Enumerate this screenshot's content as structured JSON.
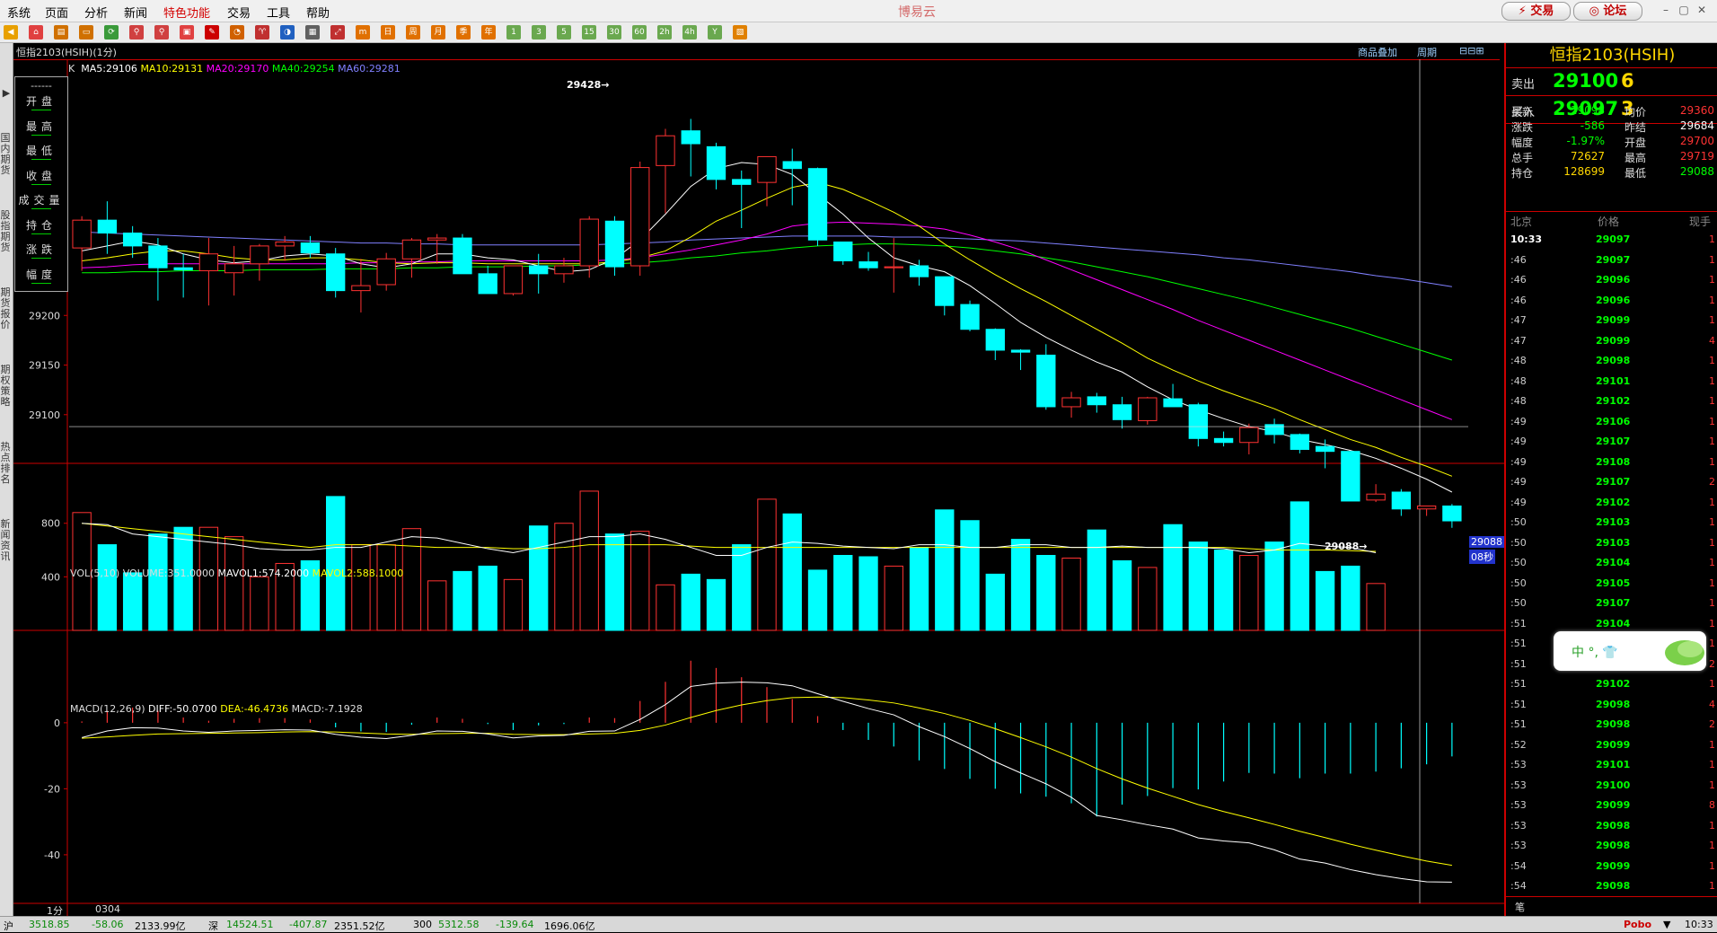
{
  "app_title": "博易云",
  "menu": [
    "系统",
    "页面",
    "分析",
    "新闻",
    "特色功能",
    "交易",
    "工具",
    "帮助"
  ],
  "menu_active_index": 4,
  "buttons": {
    "trade": "⚡ 交易",
    "forum": "◎ 论坛"
  },
  "toolbar": {
    "buttons": [
      "◀",
      "⌂",
      "▤",
      "▭",
      "⟳",
      "⚲",
      "⚲",
      "▣",
      "✎",
      "◔",
      "♈",
      "◑",
      "▦",
      "⤢",
      "m",
      "日",
      "周",
      "月",
      "季",
      "年",
      "1",
      "3",
      "5",
      "15",
      "30",
      "60",
      "2h",
      "4h",
      "Y",
      "▧"
    ],
    "colors": [
      "#e8a000",
      "#e04040",
      "#d07000",
      "#d07000",
      "#3a9a3a",
      "#d04040",
      "#d04040",
      "#e04040",
      "#c00",
      "#d06000",
      "#c03030",
      "#2060c0",
      "#606060",
      "#c03030",
      "#e07000",
      "#e07000",
      "#e07000",
      "#e07000",
      "#e07000",
      "#e07000",
      "#6aa84f",
      "#6aa84f",
      "#6aa84f",
      "#6aa84f",
      "#6aa84f",
      "#6aa84f",
      "#6aa84f",
      "#6aa84f",
      "#6aa84f",
      "#e08000"
    ]
  },
  "leftstrip_tabs": [
    "国内期货",
    "股指期货",
    "期货报价",
    "期权策略",
    "热点排名",
    "新闻资讯"
  ],
  "subheader": {
    "symbol_label": "恒指2103(HSIH)(1分)",
    "tab1": "商品叠加",
    "tab2": "周期"
  },
  "ohlc_box": {
    "title": "------",
    "rows": [
      "开盘",
      "最高",
      "最低",
      "收盘",
      "成交量",
      "持仓",
      "涨跌",
      "幅度"
    ]
  },
  "price_legend": {
    "prefix": "K",
    "ma5": "MA5:29106",
    "ma10": "MA10:29131",
    "ma20": "MA20:29170",
    "ma40": "MA40:29254",
    "ma60": "MA60:29281"
  },
  "vol_legend": {
    "vol": "VOL(5,10) VOLUME:351.0000",
    "mavol1": "MAVOL1:574.2000",
    "mavol2": "MAVOL2:588.1000"
  },
  "macd_legend": {
    "macd": "MACD(12,26,9)",
    "diff": "DIFF:-50.0700",
    "dea": "DEA:-46.4736",
    "macdv": "MACD:-7.1928"
  },
  "annotations": {
    "high": "29428→",
    "low": "29088→",
    "last": "29088",
    "countdown": "08秒",
    "period": "1分",
    "date": "0304"
  },
  "chart_data": [
    {
      "type": "candlestick",
      "title": "恒指2103(HSIH)",
      "ylim": [
        29060,
        29440
      ],
      "yticks": [
        29100,
        29150,
        29200,
        29250
      ],
      "candles": [
        [
          29268,
          29300,
          29245,
          29296
        ],
        [
          29296,
          29315,
          29262,
          29283
        ],
        [
          29283,
          29290,
          29258,
          29270
        ],
        [
          29270,
          29278,
          29215,
          29248
        ],
        [
          29248,
          29262,
          29218,
          29246
        ],
        [
          29245,
          29278,
          29210,
          29262
        ],
        [
          29243,
          29270,
          29220,
          29252
        ],
        [
          29252,
          29272,
          29235,
          29270
        ],
        [
          29270,
          29280,
          29255,
          29274
        ],
        [
          29273,
          29280,
          29258,
          29263
        ],
        [
          29262,
          29268,
          29218,
          29225
        ],
        [
          29225,
          29257,
          29203,
          29230
        ],
        [
          29231,
          29263,
          29225,
          29257
        ],
        [
          29257,
          29278,
          29238,
          29276
        ],
        [
          29276,
          29282,
          29252,
          29278
        ],
        [
          29278,
          29282,
          29245,
          29242
        ],
        [
          29242,
          29250,
          29222,
          29222
        ],
        [
          29222,
          29250,
          29220,
          29250
        ],
        [
          29250,
          29262,
          29222,
          29242
        ],
        [
          29242,
          29258,
          29233,
          29250
        ],
        [
          29250,
          29300,
          29238,
          29297
        ],
        [
          29295,
          29300,
          29240,
          29249
        ],
        [
          29250,
          29355,
          29240,
          29349
        ],
        [
          29351,
          29388,
          29303,
          29381
        ],
        [
          29386,
          29398,
          29340,
          29373
        ],
        [
          29370,
          29374,
          29327,
          29337
        ],
        [
          29337,
          29346,
          29288,
          29332
        ],
        [
          29334,
          29360,
          29310,
          29360
        ],
        [
          29355,
          29368,
          29311,
          29348
        ],
        [
          29348,
          29349,
          29270,
          29276
        ],
        [
          29274,
          29274,
          29251,
          29255
        ],
        [
          29254,
          29264,
          29245,
          29248
        ],
        [
          29248,
          29278,
          29223,
          29249
        ],
        [
          29250,
          29256,
          29230,
          29239
        ],
        [
          29239,
          29239,
          29200,
          29210
        ],
        [
          29211,
          29215,
          29184,
          29186
        ],
        [
          29186,
          29187,
          29155,
          29165
        ],
        [
          29165,
          29166,
          29145,
          29163
        ],
        [
          29160,
          29171,
          29105,
          29108
        ],
        [
          29108,
          29123,
          29097,
          29117
        ],
        [
          29118,
          29122,
          29102,
          29110
        ],
        [
          29110,
          29118,
          29086,
          29095
        ],
        [
          29094,
          29118,
          29090,
          29117
        ],
        [
          29116,
          29131,
          29108,
          29108
        ],
        [
          29110,
          29112,
          29068,
          29076
        ],
        [
          29076,
          29083,
          29068,
          29072
        ],
        [
          29072,
          29091,
          29060,
          29087
        ],
        [
          29090,
          29096,
          29071,
          29080
        ],
        [
          29080,
          29081,
          29061,
          29065
        ],
        [
          29068,
          29075,
          29046,
          29063
        ],
        [
          29063,
          29063,
          29013,
          29013
        ],
        [
          29014,
          29030,
          29012,
          29020
        ],
        [
          29022,
          29025,
          28998,
          29005
        ],
        [
          29005,
          29008,
          28998,
          29008
        ],
        [
          29008,
          29010,
          28986,
          28993
        ]
      ],
      "ma5": [
        29265,
        29270,
        29275,
        29271,
        29262,
        29256,
        29253,
        29255,
        29260,
        29262,
        29260,
        29252,
        29248,
        29252,
        29262,
        29262,
        29258,
        29256,
        29250,
        29244,
        29246,
        29257,
        29276,
        29302,
        29330,
        29348,
        29354,
        29352,
        29342,
        29322,
        29302,
        29278,
        29258,
        29250,
        29244,
        29230,
        29212,
        29193,
        29178,
        29165,
        29153,
        29143,
        29128,
        29115,
        29105,
        29096,
        29088,
        29083,
        29075,
        29070,
        29064,
        29056,
        29046,
        29035,
        29022
      ],
      "ma10": [
        29255,
        29258,
        29262,
        29265,
        29265,
        29262,
        29258,
        29256,
        29256,
        29258,
        29258,
        29256,
        29253,
        29252,
        29253,
        29253,
        29252,
        29252,
        29252,
        29252,
        29252,
        29254,
        29258,
        29265,
        29279,
        29295,
        29306,
        29318,
        29329,
        29334,
        29327,
        29316,
        29304,
        29290,
        29272,
        29256,
        29241,
        29227,
        29214,
        29200,
        29186,
        29172,
        29157,
        29145,
        29134,
        29124,
        29115,
        29106,
        29095,
        29085,
        29075,
        29067,
        29057,
        29048,
        29038
      ],
      "ma20": [
        29248,
        29249,
        29251,
        29252,
        29252,
        29252,
        29252,
        29252,
        29252,
        29252,
        29252,
        29253,
        29253,
        29254,
        29254,
        29255,
        29255,
        29255,
        29255,
        29255,
        29255,
        29256,
        29258,
        29262,
        29266,
        29271,
        29276,
        29282,
        29290,
        29293,
        29294,
        29293,
        29292,
        29290,
        29287,
        29281,
        29274,
        29266,
        29256,
        29246,
        29236,
        29226,
        29216,
        29206,
        29195,
        29185,
        29175,
        29165,
        29155,
        29145,
        29135,
        29125,
        29115,
        29105,
        29095
      ],
      "ma40": [
        29243,
        29243,
        29244,
        29244,
        29245,
        29245,
        29245,
        29246,
        29246,
        29246,
        29247,
        29247,
        29247,
        29248,
        29248,
        29249,
        29249,
        29249,
        29250,
        29250,
        29251,
        29252,
        29253,
        29255,
        29258,
        29260,
        29263,
        29265,
        29268,
        29270,
        29271,
        29272,
        29272,
        29271,
        29270,
        29268,
        29265,
        29262,
        29258,
        29254,
        29249,
        29244,
        29239,
        29233,
        29227,
        29221,
        29215,
        29208,
        29201,
        29194,
        29187,
        29179,
        29171,
        29163,
        29155
      ],
      "ma60": [
        29284,
        29283,
        29282,
        29281,
        29280,
        29279,
        29278,
        29277,
        29276,
        29275,
        29274,
        29273,
        29273,
        29272,
        29272,
        29271,
        29271,
        29271,
        29271,
        29271,
        29271,
        29272,
        29273,
        29274,
        29276,
        29277,
        29278,
        29279,
        29280,
        29280,
        29280,
        29280,
        29279,
        29279,
        29278,
        29277,
        29276,
        29275,
        29273,
        29271,
        29269,
        29267,
        29265,
        29263,
        29261,
        29258,
        29256,
        29253,
        29250,
        29247,
        29244,
        29240,
        29237,
        29233,
        29229
      ]
    },
    {
      "type": "bar",
      "title": "VOL(5,10)",
      "ylim": [
        0,
        1100
      ],
      "yticks": [
        400,
        800
      ],
      "values": [
        880,
        640,
        430,
        720,
        770,
        770,
        700,
        400,
        500,
        520,
        1000,
        640,
        640,
        760,
        370,
        440,
        480,
        380,
        780,
        800,
        1040,
        720,
        740,
        340,
        420,
        380,
        640,
        980,
        870,
        450,
        560,
        550,
        480,
        620,
        900,
        820,
        420,
        680,
        560,
        540,
        750,
        520,
        470,
        790,
        660,
        600,
        560,
        660,
        960,
        440,
        480,
        350,
        0,
        0,
        0
      ],
      "mavol1": [
        800,
        790,
        720,
        700,
        680,
        660,
        640,
        610,
        600,
        600,
        620,
        620,
        660,
        700,
        690,
        650,
        610,
        580,
        620,
        660,
        700,
        700,
        720,
        680,
        620,
        560,
        560,
        620,
        660,
        650,
        630,
        620,
        610,
        640,
        640,
        620,
        620,
        640,
        640,
        620,
        620,
        630,
        620,
        620,
        620,
        610,
        580,
        600,
        650,
        630,
        620,
        580,
        0,
        0,
        0
      ],
      "mavol2": [
        800,
        780,
        760,
        740,
        720,
        700,
        680,
        660,
        640,
        620,
        640,
        640,
        640,
        630,
        620,
        620,
        620,
        610,
        610,
        620,
        640,
        640,
        640,
        640,
        630,
        620,
        620,
        620,
        620,
        620,
        620,
        620,
        620,
        620,
        620,
        620,
        620,
        620,
        620,
        620,
        620,
        620,
        620,
        620,
        620,
        620,
        610,
        600,
        600,
        600,
        595,
        590,
        0,
        0,
        0
      ]
    },
    {
      "type": "bar",
      "title": "MACD(12,26,9)",
      "ylim": [
        -52,
        22
      ],
      "yticks": [
        0,
        -20,
        -40
      ],
      "diff": [
        -4.5,
        -2.5,
        -1.5,
        -1.6,
        -2.5,
        -2.9,
        -2.5,
        -2.3,
        -2.1,
        -2.2,
        -3.5,
        -4.4,
        -4.8,
        -3.8,
        -2.5,
        -2.6,
        -3.4,
        -4.6,
        -4.0,
        -3.8,
        -2.6,
        -2.5,
        1.0,
        5.5,
        11.0,
        12.0,
        12.3,
        12.1,
        11.2,
        8.8,
        6.5,
        4.3,
        2.4,
        -1.2,
        -4.2,
        -7.8,
        -11.8,
        -15.2,
        -18.5,
        -22.6,
        -28.1,
        -29.4,
        -30.9,
        -32.2,
        -34.9,
        -35.8,
        -36.4,
        -38.5,
        -41.3,
        -42.5,
        -44.5,
        -46.0,
        -47.2,
        -48.2,
        -48.3
      ],
      "dea": [
        -4.7,
        -4.3,
        -3.8,
        -3.4,
        -3.3,
        -3.2,
        -3.1,
        -3.0,
        -2.8,
        -2.7,
        -2.8,
        -3.1,
        -3.4,
        -3.5,
        -3.3,
        -3.2,
        -3.2,
        -3.5,
        -3.6,
        -3.6,
        -3.4,
        -3.2,
        -2.3,
        -0.7,
        1.6,
        3.7,
        5.4,
        6.7,
        7.6,
        7.8,
        7.6,
        6.9,
        6.0,
        4.5,
        2.8,
        0.7,
        -1.8,
        -4.5,
        -7.3,
        -10.4,
        -13.9,
        -17.0,
        -19.8,
        -22.3,
        -24.8,
        -26.9,
        -28.8,
        -30.8,
        -32.9,
        -34.8,
        -36.8,
        -38.6,
        -40.3,
        -41.9,
        -43.2
      ],
      "macd": [
        0.4,
        3.6,
        4.6,
        3.6,
        1.6,
        0.6,
        1.2,
        1.4,
        1.4,
        1.0,
        -1.4,
        -2.6,
        -2.8,
        -0.6,
        1.6,
        1.2,
        -0.4,
        -2.2,
        -0.8,
        -0.4,
        1.6,
        1.4,
        6.6,
        12.4,
        18.8,
        16.6,
        13.8,
        10.8,
        7.2,
        2.0,
        -2.2,
        -5.2,
        -7.2,
        -11.4,
        -14.0,
        -17.0,
        -20.0,
        -21.4,
        -22.4,
        -24.4,
        -28.4,
        -24.8,
        -22.2,
        -19.8,
        -20.2,
        -17.8,
        -15.2,
        -15.4,
        -16.8,
        -15.4,
        -15.4,
        -14.8,
        -13.8,
        -12.6,
        -10.2
      ]
    }
  ],
  "quote": {
    "title": "恒指2103(HSIH)",
    "sell_label": "卖出",
    "sell_price": "29100",
    "sell_vol": "6",
    "buy_label": "买入",
    "buy_price": "29097",
    "buy_vol": "3",
    "stats_left": [
      [
        "最新",
        "29098"
      ],
      [
        "涨跌",
        "-586"
      ],
      [
        "幅度",
        "-1.97%"
      ],
      [
        "总手",
        "72627"
      ],
      [
        "持仓",
        "128699"
      ]
    ],
    "stats_right": [
      [
        "均价",
        "29360"
      ],
      [
        "昨结",
        "29684"
      ],
      [
        "开盘",
        "29700"
      ],
      [
        "最高",
        "29719"
      ],
      [
        "最低",
        "29088"
      ]
    ],
    "ticks_header": [
      "北京",
      "价格",
      "现手"
    ],
    "ticks": [
      [
        "10:33",
        "29097",
        "1"
      ],
      [
        ":46",
        "29097",
        "1"
      ],
      [
        ":46",
        "29096",
        "1"
      ],
      [
        ":46",
        "29096",
        "1"
      ],
      [
        ":47",
        "29099",
        "1"
      ],
      [
        ":47",
        "29099",
        "4"
      ],
      [
        ":48",
        "29098",
        "1"
      ],
      [
        ":48",
        "29101",
        "1"
      ],
      [
        ":48",
        "29102",
        "1"
      ],
      [
        ":49",
        "29106",
        "1"
      ],
      [
        ":49",
        "29107",
        "1"
      ],
      [
        ":49",
        "29108",
        "1"
      ],
      [
        ":49",
        "29107",
        "2"
      ],
      [
        ":49",
        "29102",
        "1"
      ],
      [
        ":50",
        "29103",
        "1"
      ],
      [
        ":50",
        "29103",
        "1"
      ],
      [
        ":50",
        "29104",
        "1"
      ],
      [
        ":50",
        "29105",
        "1"
      ],
      [
        ":50",
        "29107",
        "1"
      ],
      [
        ":51",
        "29104",
        "1"
      ],
      [
        ":51",
        "",
        "1"
      ],
      [
        ":51",
        "",
        "2"
      ],
      [
        ":51",
        "29102",
        "1"
      ],
      [
        ":51",
        "29098",
        "4"
      ],
      [
        ":51",
        "29098",
        "2"
      ],
      [
        ":52",
        "29099",
        "1"
      ],
      [
        ":53",
        "29101",
        "1"
      ],
      [
        ":53",
        "29100",
        "1"
      ],
      [
        ":53",
        "29099",
        "8"
      ],
      [
        ":53",
        "29098",
        "1"
      ],
      [
        ":53",
        "29098",
        "1"
      ],
      [
        ":54",
        "29099",
        "1"
      ],
      [
        ":54",
        "29098",
        "1"
      ]
    ],
    "ticks_footer": "笔"
  },
  "ime": {
    "text": "中 °, 👕"
  },
  "bottom": {
    "sh_label": "沪",
    "sh_val": "3518.85",
    "sh_chg": "-58.06",
    "sh_amt": "2133.99亿",
    "sz_label": "深",
    "sz_val": "14524.51",
    "sz_chg": "-407.87",
    "sz_amt": "2351.52亿",
    "c300_label": "300",
    "c300_val": "5312.58",
    "c300_chg": "-139.64",
    "c300_amt": "1696.06亿",
    "brand": "Pobo",
    "time": "10:33"
  }
}
